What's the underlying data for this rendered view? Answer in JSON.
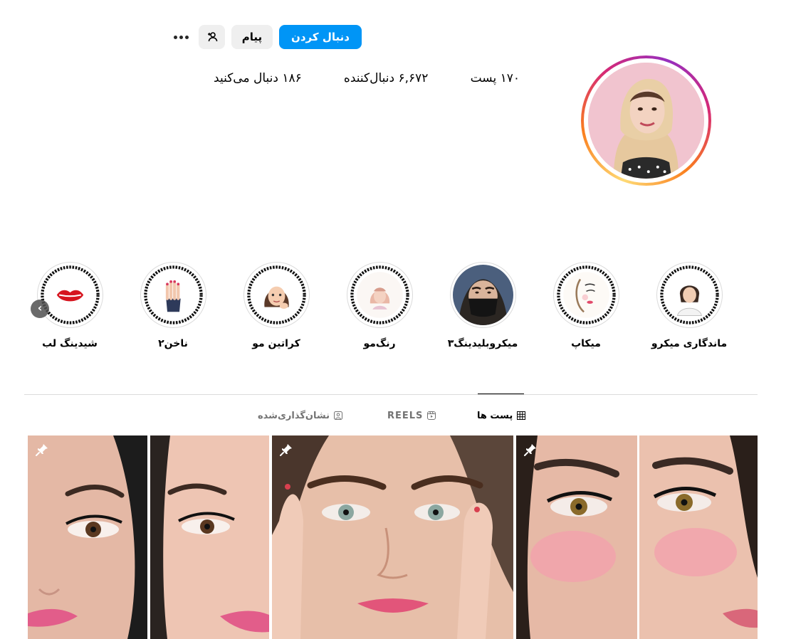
{
  "profile": {
    "actions": {
      "follow_label": "دنبال کردن",
      "message_label": "پیام",
      "suggest_icon": "person-plus-icon",
      "more_icon": "more-options-icon"
    },
    "stats": {
      "posts": "۱۷۰ پست",
      "followers": "۶,۶۷۲ دنبال‌کننده",
      "following": "۱۸۶ دنبال می‌کنید"
    }
  },
  "highlights": [
    {
      "label": "ماندگاری میکرو",
      "icon": "woman-illustration"
    },
    {
      "label": "میکاپ",
      "icon": "makeup-face-illustration"
    },
    {
      "label": "میکروبلیدینگ۳",
      "icon": "masked-woman-photo"
    },
    {
      "label": "رنگ‌مو",
      "icon": "hair-color-emoji"
    },
    {
      "label": "کراتین مو",
      "icon": "woman-emoji"
    },
    {
      "label": "ناخن۲",
      "icon": "nails-emoji"
    },
    {
      "label": "شیدینگ لب",
      "icon": "lips-emoji"
    }
  ],
  "highlights_prev_icon": "chevron-left-icon",
  "tabs": [
    {
      "label": "پست ها",
      "icon": "grid-icon",
      "active": true
    },
    {
      "label": "REELS",
      "icon": "reels-icon",
      "active": false
    },
    {
      "label": "نشان‌گذاری‌شده",
      "icon": "tagged-icon",
      "active": false
    }
  ],
  "posts": [
    {
      "pinned": true,
      "icon": "pin-icon",
      "subject": "eyelash-extension-before-after"
    },
    {
      "pinned": true,
      "icon": "pin-icon",
      "subject": "eyebrow-makeup-closeup"
    },
    {
      "pinned": true,
      "icon": "pin-icon",
      "subject": "eyelash-blush-before-after"
    }
  ],
  "colors": {
    "accent": "#0095f6",
    "button_gray": "#efefef",
    "divider": "#dbdbdb",
    "muted_text": "#737373"
  }
}
